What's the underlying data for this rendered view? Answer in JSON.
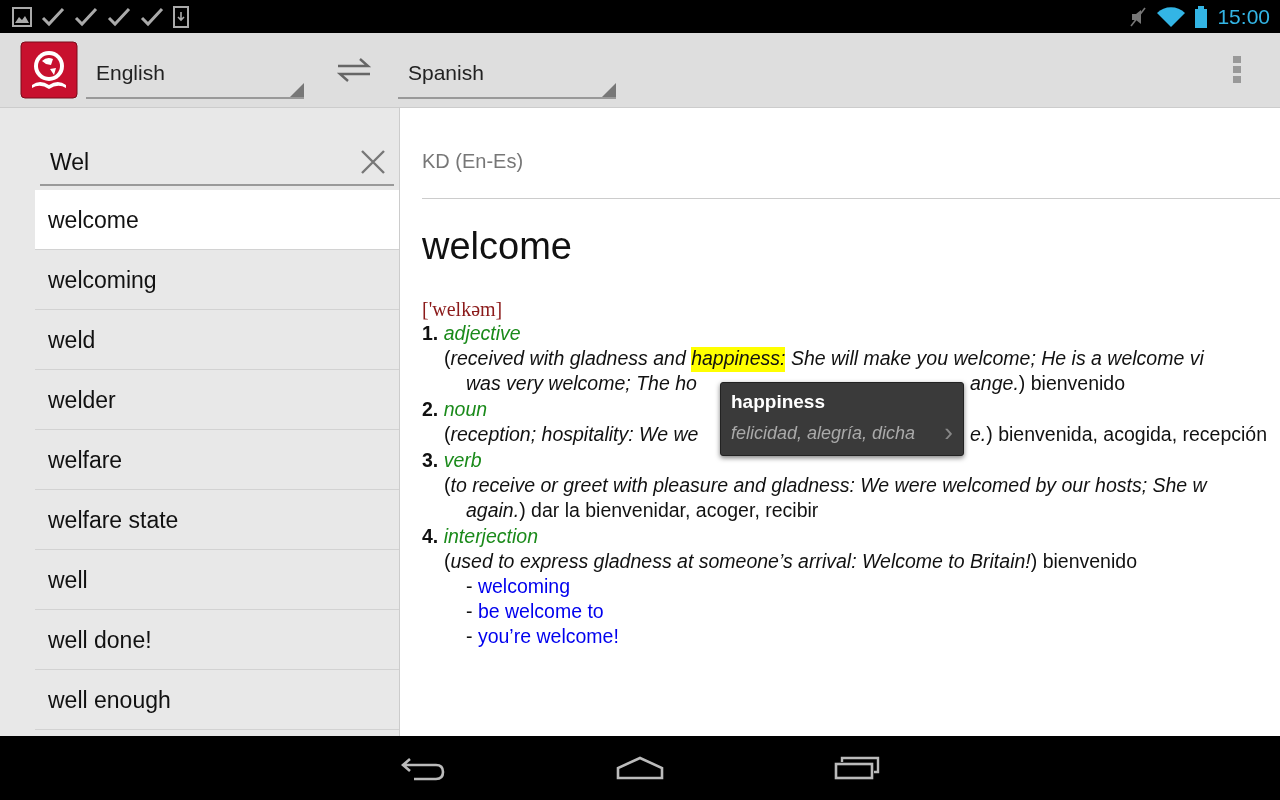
{
  "status_bar": {
    "time": "15:00"
  },
  "toolbar": {
    "source_language": "English",
    "target_language": "Spanish"
  },
  "search": {
    "value": "Wel"
  },
  "results": [
    {
      "label": "welcome",
      "selected": true
    },
    {
      "label": "welcoming",
      "selected": false
    },
    {
      "label": "weld",
      "selected": false
    },
    {
      "label": "welder",
      "selected": false
    },
    {
      "label": "welfare",
      "selected": false
    },
    {
      "label": "welfare state",
      "selected": false
    },
    {
      "label": "well",
      "selected": false
    },
    {
      "label": "well done!",
      "selected": false
    },
    {
      "label": "well enough",
      "selected": false
    }
  ],
  "entry": {
    "dictionary": "KD (En-Es)",
    "headword": "welcome",
    "pronunciation": "['welkəm]",
    "senses": [
      {
        "number": "1.",
        "part_of_speech": "adjective",
        "lines": [
          [
            {
              "text": "(*received with gladness and* ",
              "highlighted": false
            },
            {
              "text": "*happiness:*",
              "highlighted": true
            },
            {
              "text": " *She will make you welcome; He is a welcome vi*",
              "highlighted": false
            }
          ],
          [
            {
              "text": "*was very welcome; The ho*",
              "highlighted": false
            },
            {
              "text": "*ange.*) bienvenido",
              "highlighted": false
            }
          ]
        ]
      },
      {
        "number": "2.",
        "part_of_speech": "noun",
        "lines": [
          [
            {
              "text": "(*reception; hospitality: We we*",
              "highlighted": false
            },
            {
              "text": "*e.*) bienvenida, acogida, recepción",
              "highlighted": false
            }
          ]
        ]
      },
      {
        "number": "3.",
        "part_of_speech": "verb",
        "lines": [
          [
            {
              "text": "(*to receive or greet with pleasure and gladness: We were welcomed by our hosts; She w*",
              "highlighted": false
            }
          ],
          [
            {
              "text": "*again.*) dar la bienvenidar, acoger, recibir",
              "highlighted": false
            }
          ]
        ]
      },
      {
        "number": "4.",
        "part_of_speech": "interjection",
        "lines": [
          [
            {
              "text": "(*used to express gladness at someone’s arrival: Welcome to Britain!*) bienvenido",
              "highlighted": false
            }
          ]
        ]
      }
    ],
    "related": [
      {
        "dash": "-",
        "label": "welcoming"
      },
      {
        "dash": "-",
        "label": "be welcome to"
      },
      {
        "dash": "-",
        "label": "you’re welcome!"
      }
    ]
  },
  "popup": {
    "word": "happiness",
    "translation": "felicidad, alegría, dicha",
    "arrow": "›"
  }
}
